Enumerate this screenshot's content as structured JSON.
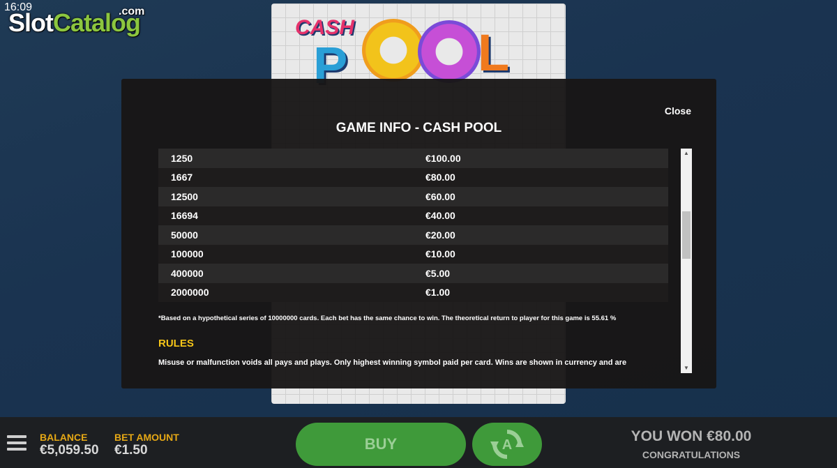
{
  "status": {
    "time": "16:09"
  },
  "logo": {
    "slot": "Slot",
    "catalog": "Catalog",
    "com": ".com"
  },
  "game": {
    "title_part1": "CASH",
    "title_part2": "POOL"
  },
  "modal": {
    "title": "GAME INFO - CASH POOL",
    "close_label": "Close",
    "paytable": [
      {
        "odds": "1250",
        "prize": "€100.00"
      },
      {
        "odds": "1667",
        "prize": "€80.00"
      },
      {
        "odds": "12500",
        "prize": "€60.00"
      },
      {
        "odds": "16694",
        "prize": "€40.00"
      },
      {
        "odds": "50000",
        "prize": "€20.00"
      },
      {
        "odds": "100000",
        "prize": "€10.00"
      },
      {
        "odds": "400000",
        "prize": "€5.00"
      },
      {
        "odds": "2000000",
        "prize": "€1.00"
      }
    ],
    "footnote": "*Based on a hypothetical series of 10000000 cards. Each bet has the same chance to win. The theoretical return to player for this game is 55.61 %",
    "rules_heading": "RULES",
    "rules_text": "Misuse or malfunction voids all pays and plays. Only highest winning symbol paid per card. Wins are shown in currency and are"
  },
  "bottom_bar": {
    "balance_label": "BALANCE",
    "balance_value": "€5,059.50",
    "bet_label": "BET AMOUNT",
    "bet_value": "€1.50",
    "buy_label": "BUY",
    "won_text": "YOU WON €80.00",
    "congrats_text": "CONGRATULATIONS"
  },
  "colors": {
    "accent_yellow": "#e6a815",
    "button_green": "#3f9a3a",
    "modal_bg": "#181616"
  }
}
